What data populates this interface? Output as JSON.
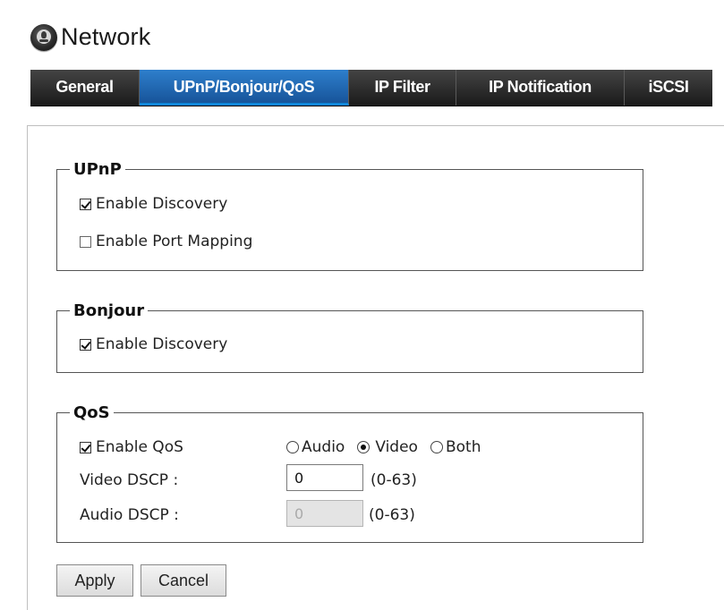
{
  "header": {
    "title": "Network",
    "icon": "network-globe-icon"
  },
  "tabs": [
    {
      "label": "General",
      "active": false
    },
    {
      "label": "UPnP/Bonjour/QoS",
      "active": true
    },
    {
      "label": "IP Filter",
      "active": false
    },
    {
      "label": "IP Notification",
      "active": false
    },
    {
      "label": "iSCSI",
      "active": false
    }
  ],
  "upnp": {
    "legend": "UPnP",
    "enable_discovery": {
      "label": "Enable Discovery",
      "checked": true
    },
    "enable_port_mapping": {
      "label": "Enable Port Mapping",
      "checked": false
    }
  },
  "bonjour": {
    "legend": "Bonjour",
    "enable_discovery": {
      "label": "Enable Discovery",
      "checked": true
    }
  },
  "qos": {
    "legend": "QoS",
    "enable_qos": {
      "label": "Enable QoS",
      "checked": true
    },
    "mode_options": [
      {
        "label": "Audio",
        "selected": false
      },
      {
        "label": "Video",
        "selected": true
      },
      {
        "label": "Both",
        "selected": false
      }
    ],
    "video_dscp": {
      "label": "Video DSCP :",
      "value": "0",
      "range": "(0-63)"
    },
    "audio_dscp": {
      "label": "Audio DSCP :",
      "value": "0",
      "range": "(0-63)",
      "disabled": true
    }
  },
  "actions": {
    "apply_label": "Apply",
    "cancel_label": "Cancel"
  },
  "colors": {
    "active_tab": "#1f6bb8",
    "tab_bar": "#2a2a2a"
  }
}
